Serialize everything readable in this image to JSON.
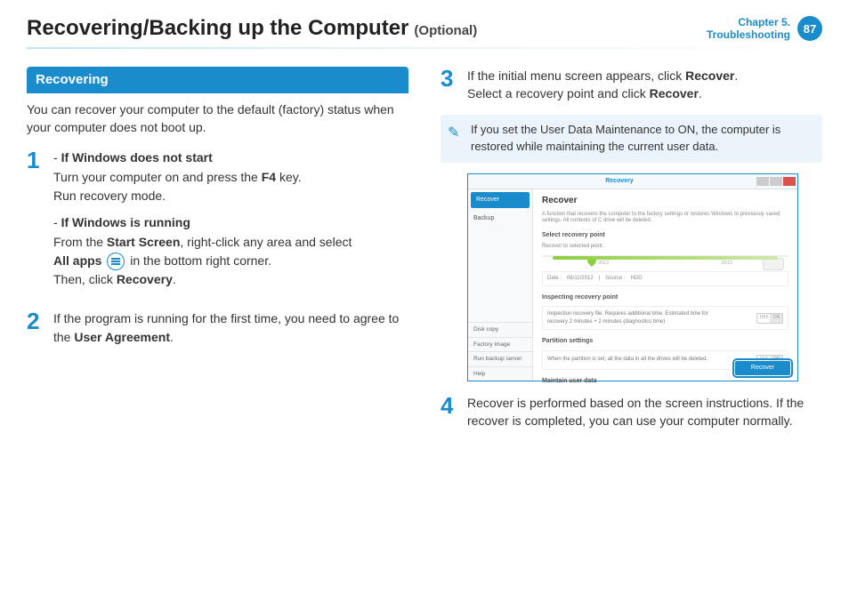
{
  "header": {
    "title": "Recovering/Backing up the Computer",
    "suffix": "(Optional)",
    "chapter_line1": "Chapter 5.",
    "chapter_line2": "Troubleshooting",
    "page_number": "87"
  },
  "left": {
    "section_title": "Recovering",
    "intro": "You can recover your computer to the default (factory) status when your computer does not boot up.",
    "step1_num": "1",
    "step1_a_dash": "- ",
    "step1_a_title": "If Windows does not start",
    "step1_a_text_pre": "Turn your computer on and press the ",
    "step1_a_key": "F4",
    "step1_a_text_post": " key.",
    "step1_a_text2": "Run recovery mode.",
    "step1_b_dash": "- ",
    "step1_b_title": "If Windows is running",
    "step1_b_line1_pre": "From the ",
    "step1_b_line1_bold": "Start Screen",
    "step1_b_line1_post": ", right-click any area and select",
    "step1_b_line2_bold": "All apps",
    "step1_b_line2_post": " in the bottom right corner.",
    "step1_b_line3_pre": "Then, click ",
    "step1_b_line3_bold": "Recovery",
    "step1_b_line3_post": ".",
    "step2_num": "2",
    "step2_text_pre": "If the program is running for the first time, you need to agree to the ",
    "step2_bold": "User Agreement",
    "step2_post": "."
  },
  "right": {
    "step3_num": "3",
    "step3_line1_pre": "If the initial menu screen appears, click ",
    "step3_line1_bold": "Recover",
    "step3_line1_post": ".",
    "step3_line2_pre": "Select a recovery point and click ",
    "step3_line2_bold": "Recover",
    "step3_line2_post": ".",
    "note": "If you set the User Data Maintenance to ON, the computer is restored while maintaining the current user data.",
    "step4_num": "4",
    "step4_text": "Recover is performed based on the screen instructions. If the recover is completed, you can use your computer normally."
  },
  "window": {
    "title": "Recovery",
    "side_recover": "Recover",
    "side_backup": "Backup",
    "side_diskcopy": "Disk copy",
    "side_factory": "Factory image",
    "side_runserver": "Run backup server",
    "side_help": "Help",
    "main_title": "Recover",
    "main_desc": "A function that recovers the computer to the factory settings or restores Windows to previously saved settings. All contents of C drive will be deleted.",
    "sec_select": "Select recovery point",
    "sec_select_sub": "Recover to selected point.",
    "tl_year1": "2012",
    "tl_year2": "2013",
    "info_date_label": "Date :",
    "info_date": "06/11/2012",
    "info_src_label": "Source :",
    "info_src": "HDD",
    "sec_inspect": "Inspecting recovery point",
    "inspect_desc": "Inspection recovery file. Requires additional time. Estimated time for recovery 2 minutes + 2 minutes (diagnostics time)",
    "sec_partition": "Partition settings",
    "partition_desc": "When the partition is set, all the data in all the drives will be deleted.",
    "sec_maintain": "Maintain user data",
    "toggle_off": "OFF",
    "toggle_on": "ON",
    "btn_recover": "Recover"
  }
}
